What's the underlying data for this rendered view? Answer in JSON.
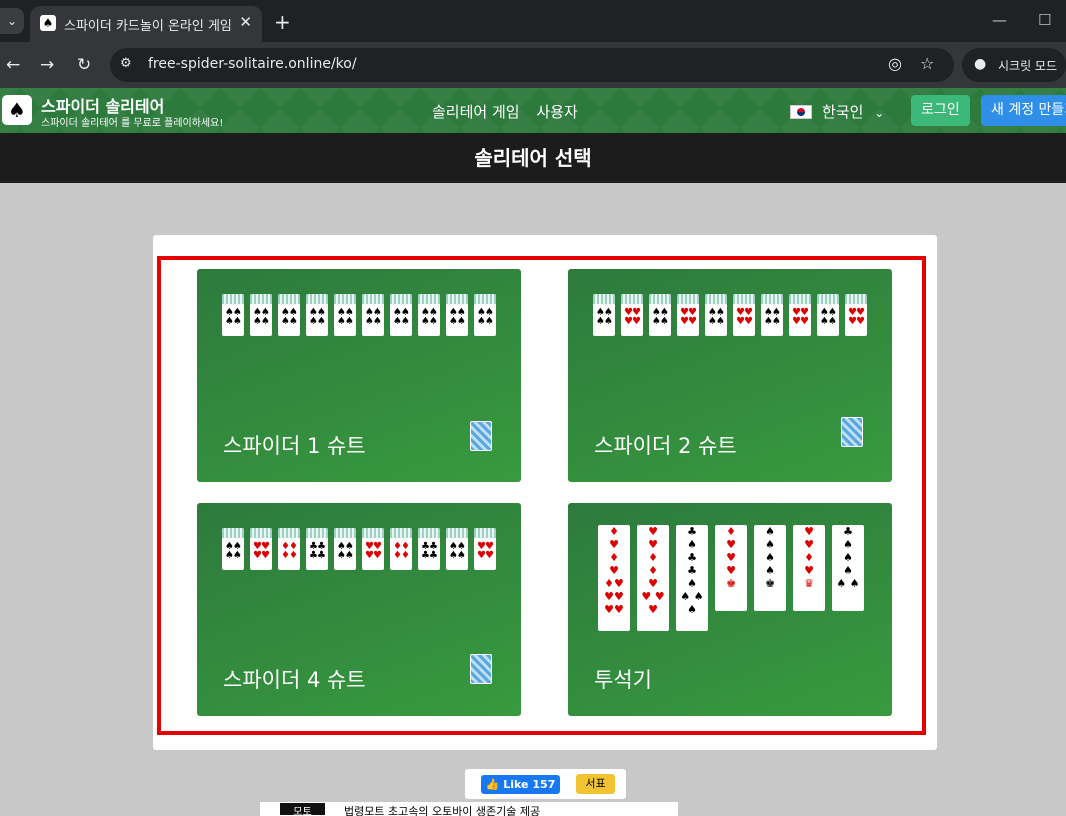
{
  "browser": {
    "tab_title": "스파이더 카드놀이 온라인 게임",
    "url": "free-spider-solitaire.online/ko/",
    "incognito_label": "시크릿 모드"
  },
  "site": {
    "brand": "스파이더 솔리테어",
    "tagline": "스파이더 솔리테어 를 무료로 플레이하세요!",
    "nav": [
      "솔리테어 게임",
      "사용자"
    ],
    "language": "한국인",
    "login": "로그인",
    "signup": "새 계정 만들기"
  },
  "selector_title": "솔리테어 선택",
  "games": [
    {
      "title": "스파이더 1 슈트"
    },
    {
      "title": "스파이더 2 슈트"
    },
    {
      "title": "스파이더 4 슈트"
    },
    {
      "title": "투석기"
    }
  ],
  "footer": {
    "like_label": "Like 157",
    "bookmark_label": "서표",
    "ad_text": "법령모트 초고속의 오토바이 생존기술 제공"
  }
}
